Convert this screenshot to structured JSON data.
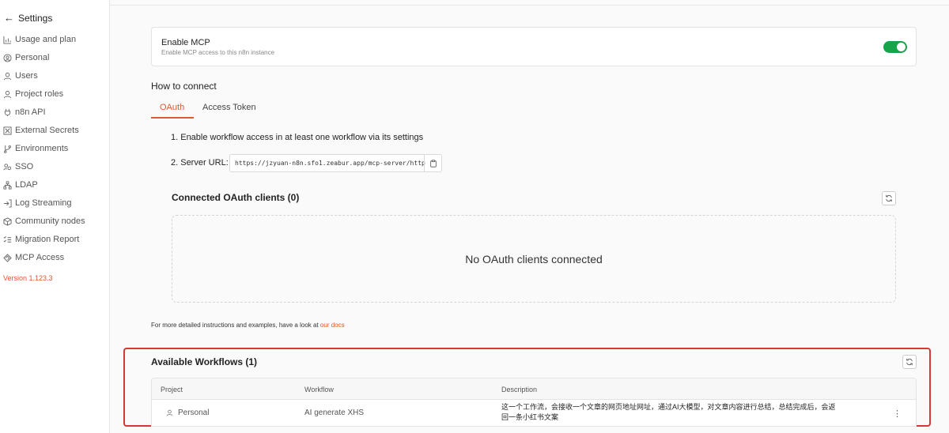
{
  "sidebar": {
    "back_label": "Settings",
    "items": [
      {
        "label": "Usage and plan",
        "icon": "bar-chart-icon"
      },
      {
        "label": "Personal",
        "icon": "user-circle-icon"
      },
      {
        "label": "Users",
        "icon": "user-icon"
      },
      {
        "label": "Project roles",
        "icon": "user-icon"
      },
      {
        "label": "n8n API",
        "icon": "plug-icon"
      },
      {
        "label": "External Secrets",
        "icon": "vault-icon"
      },
      {
        "label": "Environments",
        "icon": "git-branch-icon"
      },
      {
        "label": "SSO",
        "icon": "users-icon"
      },
      {
        "label": "LDAP",
        "icon": "network-icon"
      },
      {
        "label": "Log Streaming",
        "icon": "log-in-icon"
      },
      {
        "label": "Community nodes",
        "icon": "box-icon"
      },
      {
        "label": "Migration Report",
        "icon": "list-check-icon"
      },
      {
        "label": "MCP Access",
        "icon": "mcp-icon"
      }
    ],
    "version": "Version 1.123.3"
  },
  "mcp": {
    "title": "Enable MCP",
    "subtitle": "Enable MCP access to this n8n instance",
    "enabled": true
  },
  "connect": {
    "heading": "How to connect",
    "tabs": [
      "OAuth",
      "Access Token"
    ],
    "active_tab": "OAuth",
    "step1": "1. Enable workflow access in at least one workflow via its settings",
    "step2_label": "2. Server URL:",
    "server_url": "https://jzyuan-n8n.sfo1.zeabur.app/mcp-server/http"
  },
  "oauth": {
    "title": "Connected OAuth clients (0)",
    "empty_text": "No OAuth clients connected"
  },
  "docs": {
    "text": "For more detailed instructions and examples, have a look at",
    "link": "our docs"
  },
  "workflows": {
    "title": "Available Workflows (1)",
    "columns": [
      "Project",
      "Workflow",
      "Description"
    ],
    "rows": [
      {
        "project": "Personal",
        "workflow": "AI generate XHS",
        "description": "这一个工作流，会接收一个文章的网页地址网址，通过AI大模型，对文章内容进行总结，总结完成后，会返回一条小红书文案"
      }
    ]
  },
  "colors": {
    "accent": "#e4572e",
    "toggle_on": "#17a34a",
    "highlight_border": "#d93636"
  }
}
